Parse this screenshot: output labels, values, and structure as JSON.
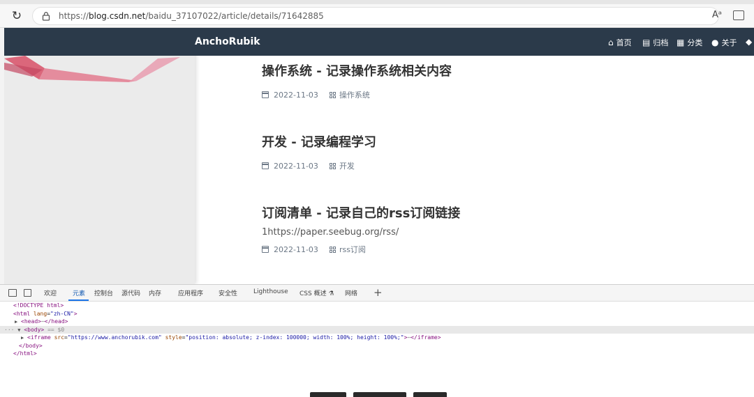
{
  "browser": {
    "url_prefix": "https://",
    "url_host": "blog.csdn.net",
    "url_path": "/baidu_37107022/article/details/71642885",
    "read_aloud_label": "Aᵃ"
  },
  "site": {
    "title": "AnchoRubik",
    "nav": [
      {
        "icon": "home-icon",
        "glyph": "⌂",
        "label": "首页"
      },
      {
        "icon": "archive-icon",
        "glyph": "▤",
        "label": "归档"
      },
      {
        "icon": "category-icon",
        "glyph": "▦",
        "label": "分类"
      },
      {
        "icon": "user-icon",
        "glyph": "●",
        "label": "关于"
      }
    ]
  },
  "posts": [
    {
      "title": "操作系统 - 记录操作系统相关内容",
      "date": "2022-11-03",
      "category": "操作系统",
      "excerpt": ""
    },
    {
      "title": "开发 - 记录编程学习",
      "date": "2022-11-03",
      "category": "开发",
      "excerpt": ""
    },
    {
      "title": "订阅清单 - 记录自己的rss订阅链接",
      "date": "2022-11-03",
      "category": "rss订阅",
      "excerpt": "1https://paper.seebug.org/rss/"
    }
  ],
  "devtools": {
    "tabs": [
      "欢迎",
      "元素",
      "控制台",
      "源代码",
      "内存",
      "应用程序",
      "安全性",
      "Lighthouse",
      "CSS 概述",
      "网络"
    ],
    "active_tab": "元素",
    "code": {
      "doctype": "<!DOCTYPE html>",
      "html_open": "<html",
      "lang_attr": "lang",
      "lang_val": "\"zh-CN\"",
      "head": "<head>",
      "head_close": "</head>",
      "body": "<body>",
      "body_marker": "== $0",
      "iframe_open": "<iframe",
      "src_attr": "src",
      "src_val": "\"https://www.anchorubik.com\"",
      "style_attr": "style",
      "style_val": "\"position: absolute; z-index: 100000; width: 100%; height: 100%;\"",
      "iframe_close": "</iframe>",
      "body_close": "</body>",
      "html_close": "</html>",
      "ellipsis": "⋯"
    }
  },
  "colors": {
    "header_bg": "#2b3a4a",
    "accent_pink": "#e06b85",
    "tag_color": "#881280",
    "attr_color": "#994500",
    "value_color": "#1a1aa6"
  }
}
